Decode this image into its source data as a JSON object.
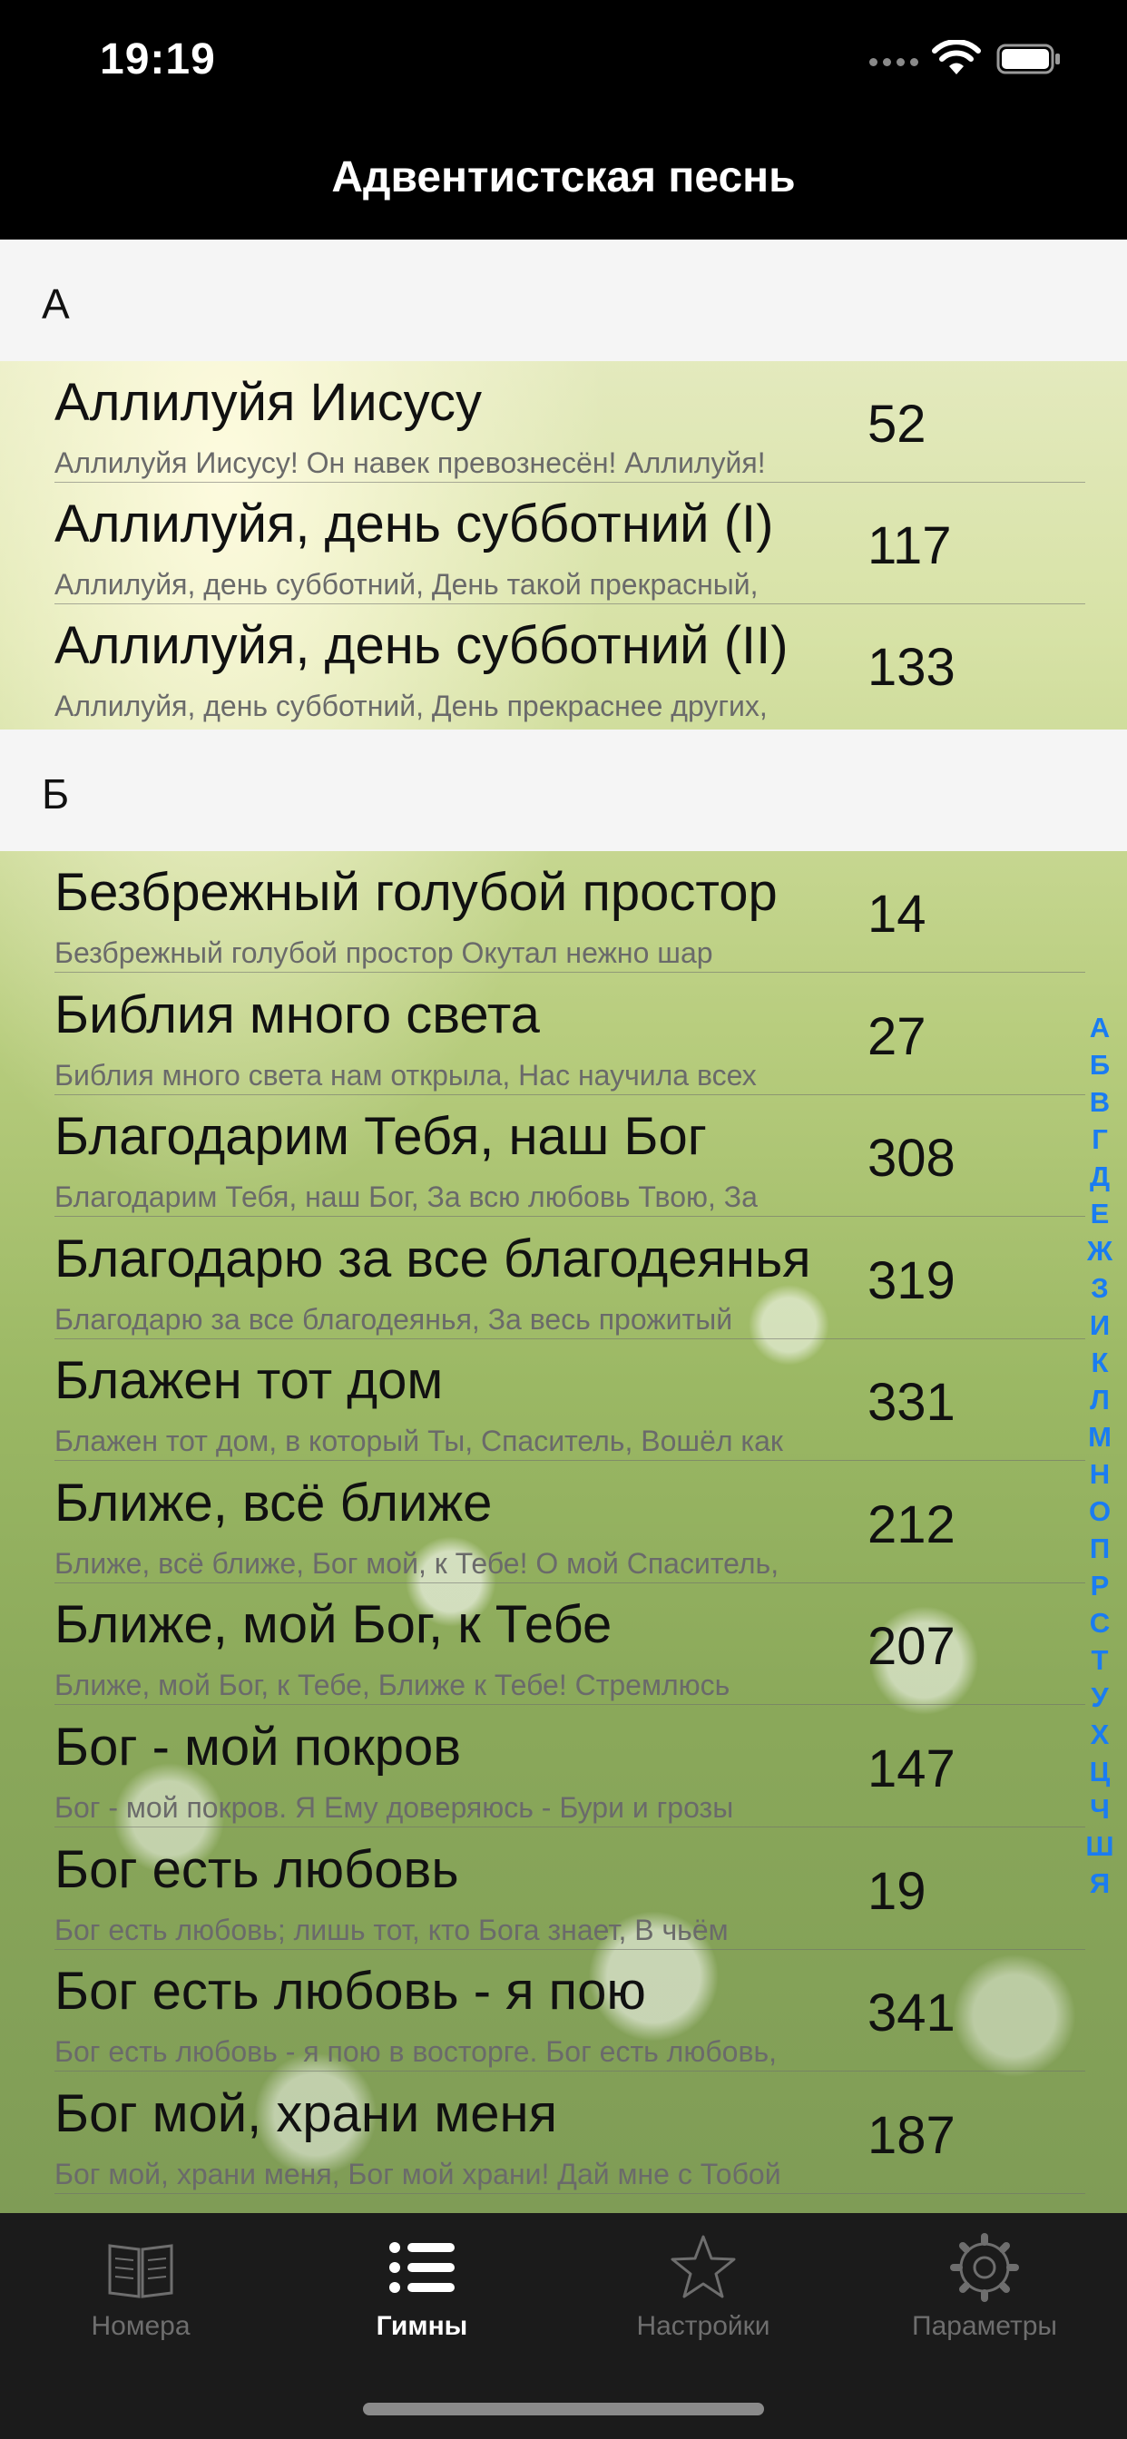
{
  "status": {
    "time": "19:19"
  },
  "nav": {
    "title": "Адвентистская песнь"
  },
  "sections": [
    {
      "letter": "А",
      "rows": [
        {
          "title": "Аллилуйя Иисусу",
          "subtitle": "Аллилуйя Иисусу! Он навек превознесён! Аллилуйя!",
          "number": "52"
        },
        {
          "title": "Аллилуйя, день субботний (I)",
          "subtitle": "Аллилуйя, день субботний, День такой прекрасный,",
          "number": "117"
        },
        {
          "title": "Аллилуйя, день субботний (II)",
          "subtitle": "Аллилуйя, день субботний, День прекраснее других,",
          "number": "133"
        }
      ]
    },
    {
      "letter": "Б",
      "rows": [
        {
          "title": "Безбрежный голубой простор",
          "subtitle": "Безбрежный голубой простор Окутал нежно шар",
          "number": "14"
        },
        {
          "title": "Библия много света",
          "subtitle": "Библия много света нам открыла, Нас научила всех",
          "number": "27"
        },
        {
          "title": "Благодарим Тебя, наш Бог",
          "subtitle": "Благодарим Тебя, наш Бог, За всю любовь Твою, За",
          "number": "308"
        },
        {
          "title": "Благодарю за все благодеянья",
          "subtitle": "Благодарю за все благодеянья, За весь прожитый",
          "number": "319"
        },
        {
          "title": "Блажен тот дом",
          "subtitle": "Блажен тот дом, в который Ты, Спаситель, Вошёл как",
          "number": "331"
        },
        {
          "title": "Ближе, всё ближе",
          "subtitle": "Ближе, всё ближе, Бог мой, к Тебе! О мой Спаситель,",
          "number": "212"
        },
        {
          "title": "Ближе, мой Бог, к Тебе",
          "subtitle": "Ближе, мой Бог, к Тебе, Ближе к Тебе! Стремлюсь",
          "number": "207"
        },
        {
          "title": "Бог - мой покров",
          "subtitle": "Бог - мой покров. Я Ему доверяюсь - Бури и грозы",
          "number": "147"
        },
        {
          "title": "Бог есть любовь",
          "subtitle": "Бог есть любовь; лишь тот, кто Бога знает, В чьём",
          "number": "19"
        },
        {
          "title": "Бог есть любовь - я пою",
          "subtitle": "Бог есть любовь - я пою в восторге. Бог есть любовь,",
          "number": "341"
        },
        {
          "title": "Бог мой, храни меня",
          "subtitle": "Бог мой, храни меня, Бог мой храни! Дай мне с Тобой",
          "number": "187"
        }
      ]
    }
  ],
  "index_letters": [
    "А",
    "Б",
    "В",
    "Г",
    "Д",
    "Е",
    "Ж",
    "З",
    "И",
    "К",
    "Л",
    "М",
    "Н",
    "О",
    "П",
    "Р",
    "С",
    "Т",
    "У",
    "Х",
    "Ц",
    "Ч",
    "Ш",
    "Я"
  ],
  "tabs": [
    {
      "label": "Номера",
      "icon": "book-icon"
    },
    {
      "label": "Гимны",
      "icon": "list-icon",
      "active": true
    },
    {
      "label": "Настройки",
      "icon": "star-icon"
    },
    {
      "label": "Параметры",
      "icon": "gear-icon"
    }
  ],
  "colors": {
    "index": "#1a7cf2",
    "tab_active": "#ffffff",
    "tab_inactive": "#6e6e6e"
  }
}
